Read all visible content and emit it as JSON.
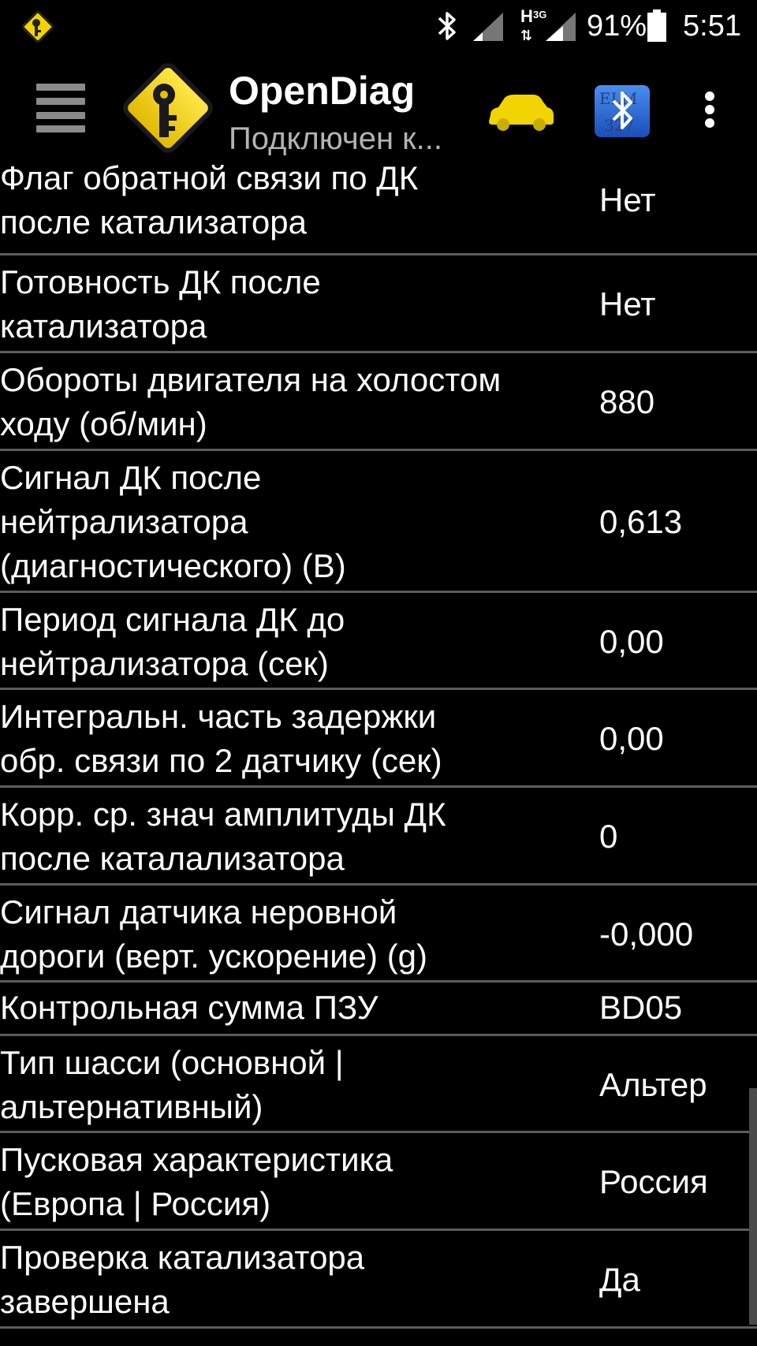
{
  "status_bar": {
    "network_type": "H",
    "network_gen": "3G",
    "battery_percent": "91%",
    "time": "5:51"
  },
  "action_bar": {
    "title": "OpenDiag",
    "subtitle": "Подключен к...",
    "icons": [
      "menu-icon",
      "app-logo-icon",
      "car-icon",
      "elm327-bluetooth-icon",
      "overflow-menu-icon"
    ]
  },
  "rows": [
    {
      "label": "Флаг обратной связи по ДК\nпосле катализатора",
      "value": "Нет"
    },
    {
      "label": "Готовность ДК после\nкатализатора",
      "value": "Нет"
    },
    {
      "label": "Обороты двигателя на холостом\nходу (об/мин)",
      "value": "880"
    },
    {
      "label": "Сигнал ДК после\nнейтрализатора\n(диагностического) (В)",
      "value": "0,613"
    },
    {
      "label": "Период сигнала ДК до\nнейтрализатора (сек)",
      "value": "0,00"
    },
    {
      "label": "Интегральн. часть задержки\nобр. связи по 2 датчику (сек)",
      "value": "0,00"
    },
    {
      "label": "Корр. ср. знач амплитуды ДК\nпосле каталализатора",
      "value": "0"
    },
    {
      "label": "Сигнал датчика неровной\nдороги (верт. ускорение) (g)",
      "value": "-0,000"
    },
    {
      "label": "Контрольная сумма ПЗУ",
      "value": "BD05"
    },
    {
      "label": "Тип шасси (основной |\nальтернативный)",
      "value": "Альтер"
    },
    {
      "label": "Пусковая характеристика\n(Европа | Россия)",
      "value": "Россия"
    },
    {
      "label": "Проверка катализатора\nзавершена",
      "value": "Да"
    }
  ],
  "colors": {
    "background": "#000000",
    "text": "#ffffff",
    "subtitle": "#b3b3b3",
    "divider": "#5c5c5c",
    "logo_yellow": "#f5d100",
    "car_yellow": "#f2d400",
    "elm_blue": "#1f5fd6"
  }
}
